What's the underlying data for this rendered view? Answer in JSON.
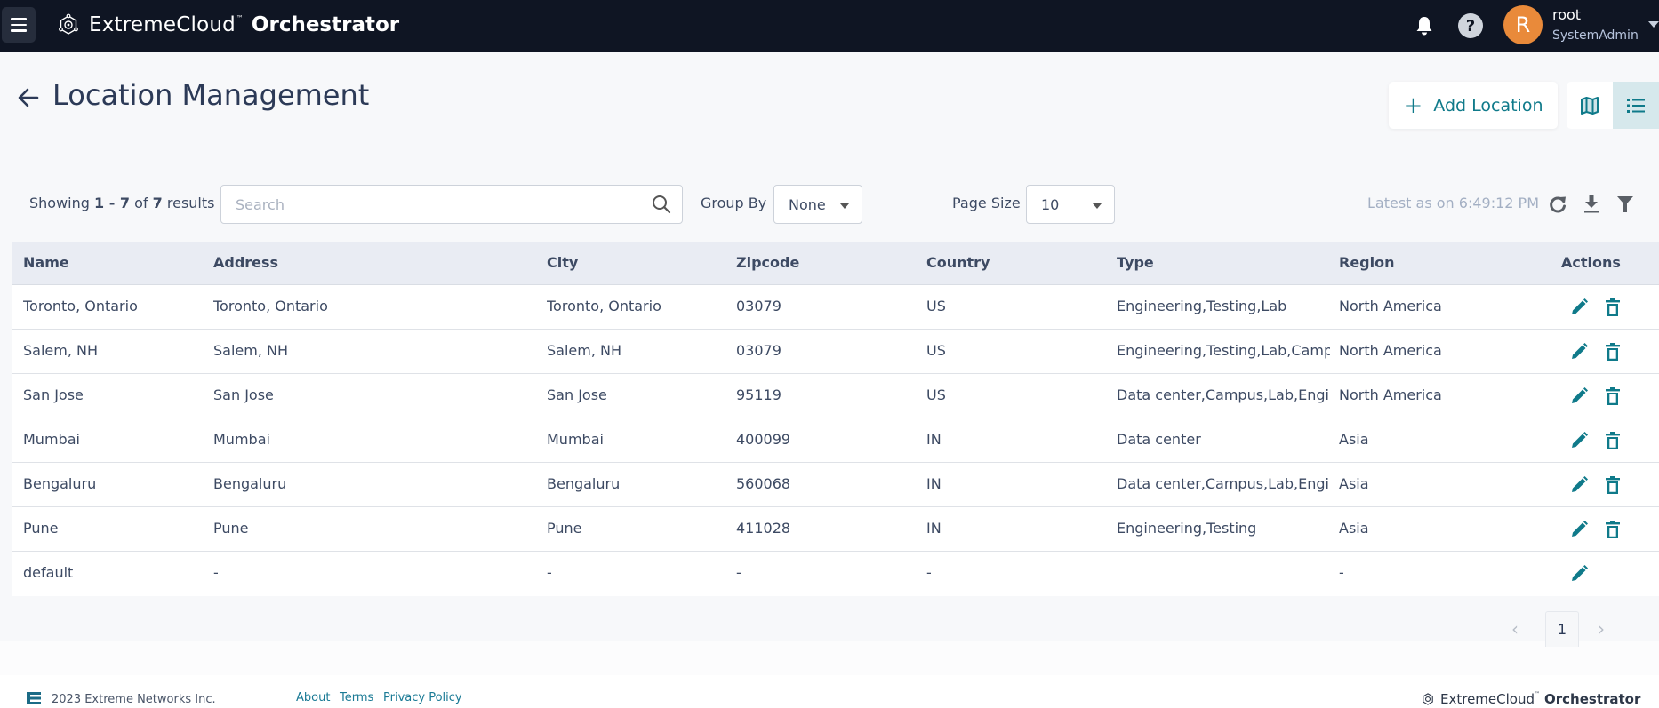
{
  "app": {
    "brand_light": "ExtremeCloud",
    "brand_tm": "™",
    "brand_bold": "Orchestrator"
  },
  "user": {
    "avatar_initial": "R",
    "name": "root",
    "role": "SystemAdmin"
  },
  "icons": {
    "menu": "hamburger-icon",
    "notifications": "bell-icon",
    "help": "question-circle-icon",
    "back": "arrow-left-icon",
    "map_view": "map-icon",
    "list_view": "list-icon",
    "search": "search-icon",
    "refresh": "refresh-icon",
    "download": "download-icon",
    "filter": "filter-icon",
    "edit": "pencil-icon",
    "delete": "trash-icon"
  },
  "page": {
    "title": "Location Management",
    "add_button": "Add Location",
    "add_button_icon": "+"
  },
  "toolbar": {
    "showing_prefix": "Showing ",
    "range_start": "1",
    "range_sep": " - ",
    "range_end": "7",
    "of": " of ",
    "total": "7",
    "suffix": " results",
    "search_placeholder": "Search",
    "search_value": "",
    "group_by_label": "Group By",
    "group_by_value": "None",
    "page_size_label": "Page Size",
    "page_size_value": "10",
    "latest": "Latest as on 6:49:12 PM"
  },
  "table": {
    "columns": [
      "Name",
      "Address",
      "City",
      "Zipcode",
      "Country",
      "Type",
      "Region",
      "Actions"
    ],
    "rows": [
      {
        "name": "Toronto, Ontario",
        "address": "Toronto, Ontario",
        "city": "Toronto, Ontario",
        "zipcode": "03079",
        "country": "US",
        "type": "Engineering,Testing,Lab",
        "region": "North America",
        "can_delete": true
      },
      {
        "name": "Salem, NH",
        "address": "Salem, NH",
        "city": "Salem, NH",
        "zipcode": "03079",
        "country": "US",
        "type": "Engineering,Testing,Lab,Campus",
        "region": "North America",
        "can_delete": true
      },
      {
        "name": "San Jose",
        "address": "San Jose",
        "city": "San Jose",
        "zipcode": "95119",
        "country": "US",
        "type": "Data center,Campus,Lab,Engineering",
        "region": "North America",
        "can_delete": true
      },
      {
        "name": "Mumbai",
        "address": "Mumbai",
        "city": "Mumbai",
        "zipcode": "400099",
        "country": "IN",
        "type": "Data center",
        "region": "Asia",
        "can_delete": true
      },
      {
        "name": "Bengaluru",
        "address": "Bengaluru",
        "city": "Bengaluru",
        "zipcode": "560068",
        "country": "IN",
        "type": "Data center,Campus,Lab,Engineering",
        "region": "Asia",
        "can_delete": true
      },
      {
        "name": "Pune",
        "address": "Pune",
        "city": "Pune",
        "zipcode": "411028",
        "country": "IN",
        "type": "Engineering,Testing",
        "region": "Asia",
        "can_delete": true
      },
      {
        "name": "default",
        "address": "-",
        "city": "-",
        "zipcode": "-",
        "country": "-",
        "type": "",
        "region": "-",
        "can_delete": false
      }
    ]
  },
  "pagination": {
    "prev": "‹",
    "current_page": "1",
    "next": "›"
  },
  "footer": {
    "copyright": "2023 Extreme Networks Inc.",
    "links": [
      "About",
      "Terms",
      "Privacy Policy"
    ],
    "brand_light": "ExtremeCloud",
    "brand_tm": "™",
    "brand_bold": "Orchestrator"
  },
  "colors": {
    "topbar": "#0f1523",
    "accent": "#0f7a8a",
    "avatar": "#e98a3a",
    "table_header": "#e9ecf3",
    "list_view_active": "#d6e8ec"
  }
}
